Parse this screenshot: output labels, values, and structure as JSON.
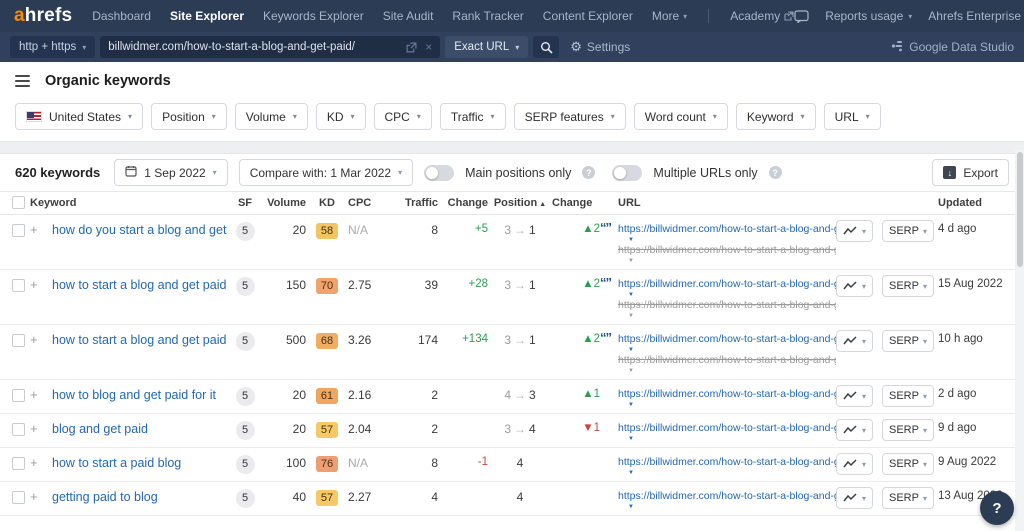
{
  "colors": {
    "brand_orange": "#ff8800",
    "nav_bar": "#2c3c55",
    "link_blue": "#2268b2",
    "positive_green": "#2b9e4e",
    "negative_red": "#c9473a",
    "quotes_navy": "#1d4f8f",
    "sf_badge_gray": "#ebebed"
  },
  "icons": {
    "caret_down": "▾",
    "expand": "▼",
    "plus": "+",
    "close": "×",
    "gear": "⚙",
    "question": "?",
    "sort_asc": "▲",
    "quotes": "“”",
    "export_arrow": "↓"
  },
  "topnav": {
    "logo_a": "a",
    "logo_rest": "hrefs",
    "items": [
      "Dashboard",
      "Site Explorer",
      "Keywords Explorer",
      "Site Audit",
      "Rank Tracker",
      "Content Explorer",
      "More"
    ],
    "academy_label": "Academy",
    "reports_usage": "Reports usage",
    "enterprise": "Ahrefs Enterprise"
  },
  "searchbar": {
    "protocol": "http + https",
    "url_value": "billwidmer.com/how-to-start-a-blog-and-get-paid/",
    "mode": "Exact URL",
    "settings_label": "Settings",
    "gds_label": "Google Data Studio"
  },
  "page_title": "Organic keywords",
  "filters": {
    "country": "United States",
    "items": [
      "Position",
      "Volume",
      "KD",
      "CPC",
      "Traffic",
      "SERP features",
      "Word count",
      "Keyword",
      "URL"
    ]
  },
  "toolbar": {
    "count": "620 keywords",
    "date": "1 Sep 2022",
    "compare": "Compare with: 1 Mar 2022",
    "main_positions": "Main positions only",
    "multiple_urls": "Multiple URLs only",
    "export": "Export"
  },
  "table": {
    "serp_label": "SERP",
    "headers": {
      "keyword": "Keyword",
      "sf": "SF",
      "volume": "Volume",
      "kd": "KD",
      "cpc": "CPC",
      "traffic": "Traffic",
      "change": "Change",
      "position": "Position",
      "change2": "Change",
      "url": "URL",
      "updated": "Updated"
    },
    "rows": [
      {
        "keyword": "how do you start a blog and get paid for it",
        "sf": "5",
        "volume": "20",
        "kd": "58",
        "kd_color": "#f3c464",
        "cpc": "N/A",
        "traffic": "8",
        "traffic_change": "+5",
        "traffic_change_dir": "up",
        "pos_from": "3",
        "pos_arrow": "→",
        "pos_to": "1",
        "pos_change": "▲2",
        "pos_change_dir": "up",
        "quotes": true,
        "url": "https://billwidmer.com/how-to-start-a-blog-and-get-paid/",
        "old_url": "https://billwidmer.com/how-to-start-a-blog-and-get-paid/",
        "updated": "4 d ago"
      },
      {
        "keyword": "how to start a blog and get paid for it",
        "sf": "5",
        "volume": "150",
        "kd": "70",
        "kd_color": "#f2a26b",
        "cpc": "2.75",
        "traffic": "39",
        "traffic_change": "+28",
        "traffic_change_dir": "up",
        "pos_from": "3",
        "pos_arrow": "→",
        "pos_to": "1",
        "pos_change": "▲2",
        "pos_change_dir": "up",
        "quotes": true,
        "url": "https://billwidmer.com/how-to-start-a-blog-and-get-paid/",
        "old_url": "https://billwidmer.com/how-to-start-a-blog-and-get-paid/",
        "updated": "15 Aug 2022"
      },
      {
        "keyword": "how to start a blog and get paid",
        "sf": "5",
        "volume": "500",
        "kd": "68",
        "kd_color": "#f2ad63",
        "cpc": "3.26",
        "traffic": "174",
        "traffic_change": "+134",
        "traffic_change_dir": "up",
        "pos_from": "3",
        "pos_arrow": "→",
        "pos_to": "1",
        "pos_change": "▲2",
        "pos_change_dir": "up",
        "quotes": true,
        "url": "https://billwidmer.com/how-to-start-a-blog-and-get-paid/",
        "old_url": "https://billwidmer.com/how-to-start-a-blog-and-get-paid/",
        "updated": "10 h ago"
      },
      {
        "keyword": "how to blog and get paid for it",
        "sf": "5",
        "volume": "20",
        "kd": "61",
        "kd_color": "#f1a660",
        "cpc": "2.16",
        "traffic": "2",
        "traffic_change": "",
        "traffic_change_dir": "",
        "pos_from": "4",
        "pos_arrow": "→",
        "pos_to": "3",
        "pos_change": "▲1",
        "pos_change_dir": "up",
        "quotes": false,
        "url": "https://billwidmer.com/how-to-start-a-blog-and-get-paid/",
        "old_url": "",
        "updated": "2 d ago"
      },
      {
        "keyword": "blog and get paid",
        "sf": "5",
        "volume": "20",
        "kd": "57",
        "kd_color": "#f5c966",
        "cpc": "2.04",
        "traffic": "2",
        "traffic_change": "",
        "traffic_change_dir": "",
        "pos_from": "3",
        "pos_arrow": "→",
        "pos_to": "4",
        "pos_change": "▼1",
        "pos_change_dir": "down",
        "quotes": false,
        "url": "https://billwidmer.com/how-to-start-a-blog-and-get-paid/",
        "old_url": "",
        "updated": "9 d ago"
      },
      {
        "keyword": "how to start a paid blog",
        "sf": "5",
        "volume": "100",
        "kd": "76",
        "kd_color": "#ef9e74",
        "cpc": "N/A",
        "traffic": "8",
        "traffic_change": "-1",
        "traffic_change_dir": "down",
        "pos_from": "",
        "pos_arrow": "",
        "pos_to": "4",
        "pos_change": "",
        "pos_change_dir": "",
        "quotes": false,
        "url": "https://billwidmer.com/how-to-start-a-blog-and-get-paid/",
        "old_url": "",
        "updated": "9 Aug 2022"
      },
      {
        "keyword": "getting paid to blog",
        "sf": "5",
        "volume": "40",
        "kd": "57",
        "kd_color": "#f5c966",
        "cpc": "2.27",
        "traffic": "4",
        "traffic_change": "",
        "traffic_change_dir": "",
        "pos_from": "",
        "pos_arrow": "",
        "pos_to": "4",
        "pos_change": "",
        "pos_change_dir": "",
        "quotes": false,
        "url": "https://billwidmer.com/how-to-start-a-blog-and-get-paid/",
        "old_url": "",
        "updated": "13 Aug 2022"
      }
    ]
  },
  "help_label": "?"
}
